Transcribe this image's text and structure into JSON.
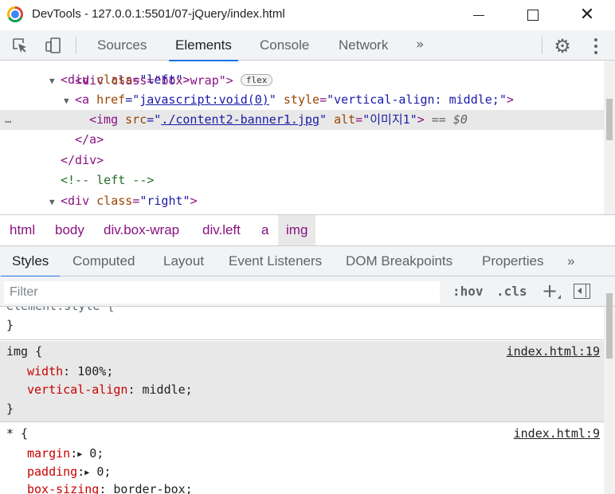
{
  "window": {
    "title": "DevTools - 127.0.0.1:5501/07-jQuery/index.html"
  },
  "toolbar": {
    "tabs": [
      {
        "label": "Sources"
      },
      {
        "label": "Elements"
      },
      {
        "label": "Console"
      },
      {
        "label": "Network"
      }
    ],
    "more": "»",
    "active_tab": "Elements"
  },
  "dom": {
    "line0": {
      "open": "<div class=\"box-wrap\">",
      "badge": "flex"
    },
    "line1": {
      "tag_open": "<div",
      "attr": "class",
      "val": "\"left\"",
      "close": ">"
    },
    "line2": {
      "tag_open": "<a",
      "attr1": "href",
      "eq1": "=\"",
      "link": "javascript:void(0)",
      "q1": "\"",
      "attr2": "style",
      "val2": "\"vertical-align: middle;\"",
      "close": ">"
    },
    "line3": {
      "tag_open": "<img",
      "attr1": "src",
      "eq1": "=\"",
      "link": "./content2-banner1.jpg",
      "q1": "\"",
      "attr2": "alt",
      "val2": "\"이미지1\"",
      "close": ">",
      "marker": "== $0"
    },
    "line4": {
      "text": "</a>"
    },
    "line5": {
      "text": "</div>"
    },
    "line6": {
      "text": "<!-- left -->"
    },
    "line7": {
      "tag_open": "<div",
      "attr": "class",
      "val": "\"right\"",
      "close": ">"
    },
    "dots": "…"
  },
  "breadcrumb": [
    "html",
    "body",
    "div.box-wrap",
    "div.left",
    "a",
    "img"
  ],
  "subtabs": [
    "Styles",
    "Computed",
    "Layout",
    "Event Listeners",
    "DOM Breakpoints",
    "Properties",
    "»"
  ],
  "filter": {
    "placeholder": "Filter",
    "hov": ":hov",
    "cls": ".cls",
    "plus": "+"
  },
  "styles": {
    "element_style": {
      "selector": "element.style {",
      "close": "}"
    },
    "rule_img": {
      "selector": "img {",
      "source": "index.html:19",
      "props": [
        {
          "name": "width",
          "value": "100%;"
        },
        {
          "name": "vertical-align",
          "value": "middle;"
        }
      ],
      "close": "}"
    },
    "rule_star": {
      "selector": "* {",
      "source": "index.html:9",
      "props": [
        {
          "name": "margin",
          "value": "0;",
          "expandable": "▶"
        },
        {
          "name": "padding",
          "value": "0;",
          "expandable": "▶"
        },
        {
          "name": "box-sizing",
          "value": "border-box;"
        }
      ]
    }
  },
  "colors": {
    "accent": "#1a73e8",
    "tag": "#881280",
    "attr_name": "#994500",
    "attr_value": "#1a1aa6",
    "css_property": "#c80000",
    "comment": "#236e25"
  }
}
